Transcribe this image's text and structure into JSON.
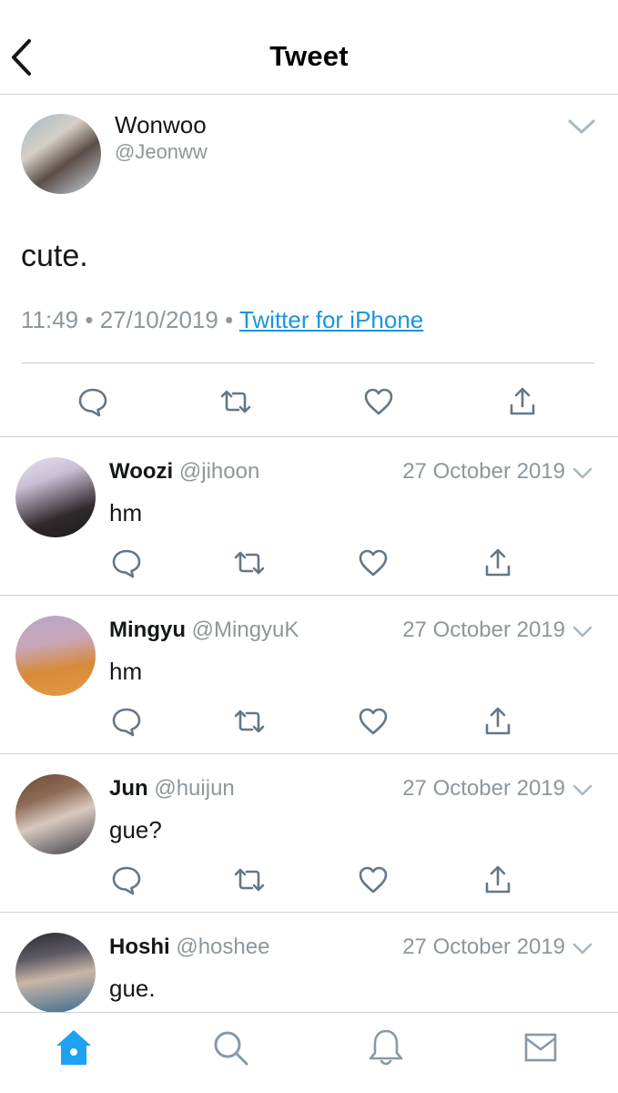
{
  "header": {
    "title": "Tweet"
  },
  "main_tweet": {
    "name": "Wonwoo",
    "handle": "@Jeonww",
    "text": "cute.",
    "time": "11:49",
    "separator": " • ",
    "date": "27/10/2019",
    "source": "Twitter for iPhone"
  },
  "replies": [
    {
      "name": "Woozi",
      "handle": "@jihoon",
      "date": "27 October 2019",
      "text": "hm"
    },
    {
      "name": "Mingyu",
      "handle": "@MingyuK",
      "date": "27 October 2019",
      "text": "hm"
    },
    {
      "name": "Jun",
      "handle": "@huijun",
      "date": "27 October 2019",
      "text": "gue?"
    },
    {
      "name": "Hoshi",
      "handle": "@hoshee",
      "date": "27 October 2019",
      "text": "gue."
    }
  ],
  "icons": {
    "action_color": "#657786",
    "active_tab_color": "#1da1f2",
    "tabs": [
      "home-icon",
      "search-icon",
      "notifications-icon",
      "messages-icon"
    ]
  }
}
